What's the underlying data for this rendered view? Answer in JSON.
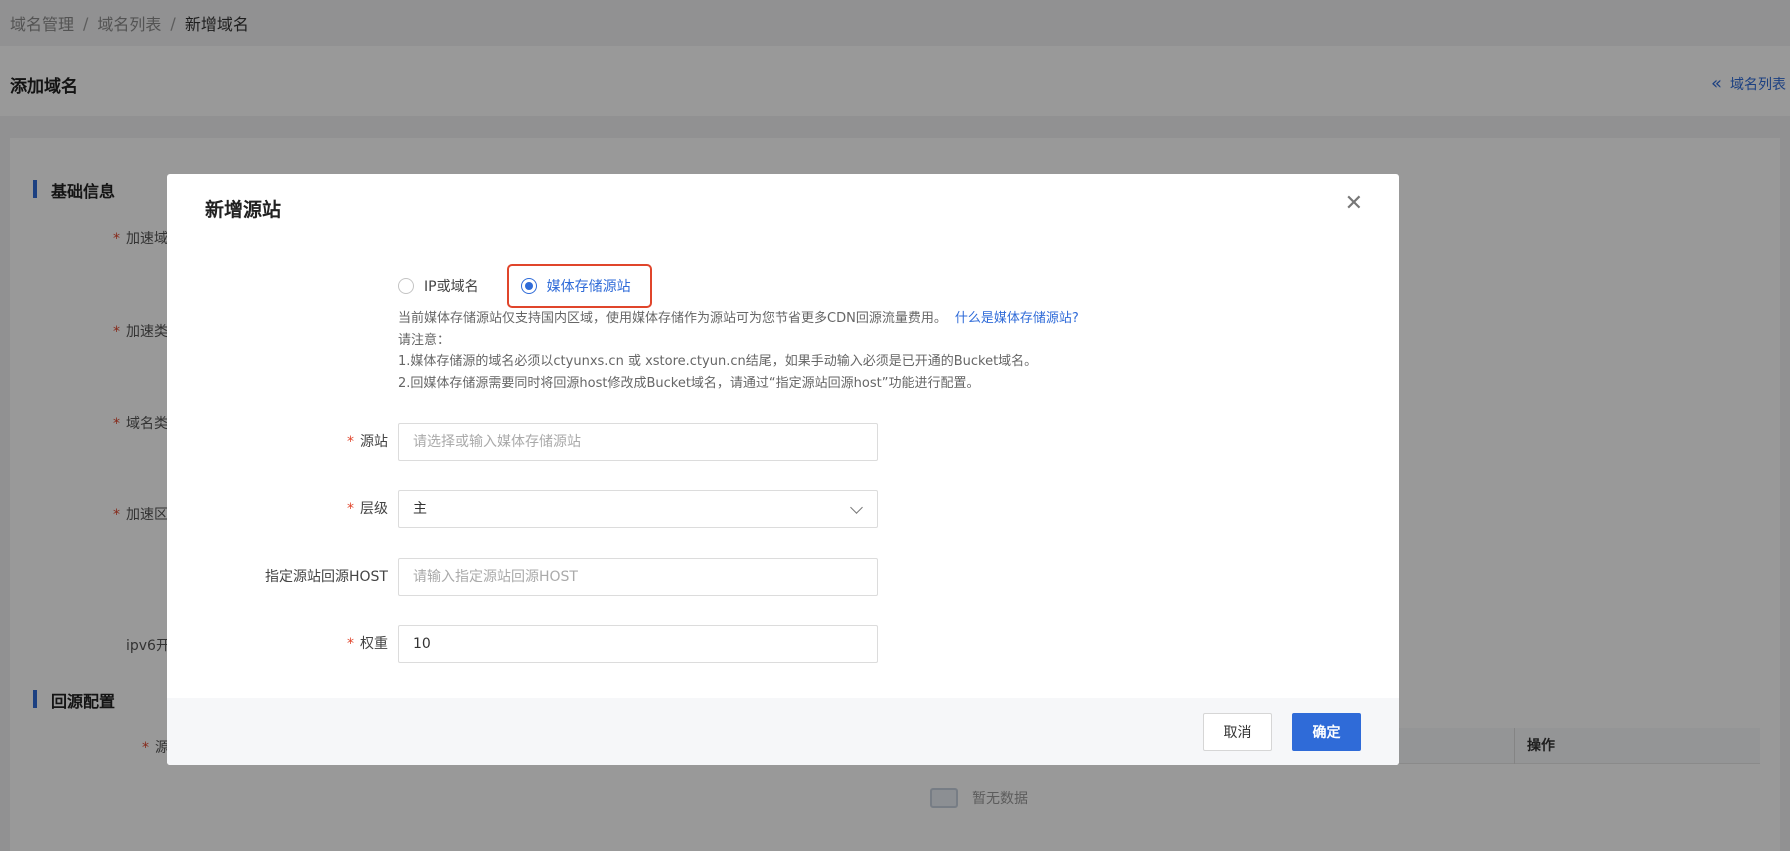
{
  "breadcrumb": {
    "items": [
      "域名管理",
      "域名列表",
      "新增域名"
    ]
  },
  "page": {
    "title": "添加域名",
    "back_link": "域名列表"
  },
  "background_form": {
    "section_basic": "基础信息",
    "fields": [
      "加速域",
      "加速类",
      "域名类",
      "加速区",
      "ipv6开"
    ],
    "section_origin": "回源配置",
    "origin_field": "源",
    "table_ops_header": "操作",
    "empty_text": "暂无数据"
  },
  "modal": {
    "title": "新增源站",
    "origin_type": {
      "options": [
        "IP或域名",
        "媒体存储源站"
      ],
      "selected": "媒体存储源站"
    },
    "notes": {
      "line1": "当前媒体存储源站仅支持国内区域，使用媒体存储作为源站可为您节省更多CDN回源流量费用。",
      "line1_link": "什么是媒体存储源站?",
      "line2": "请注意：",
      "line3": "1.媒体存储源的域名必须以ctyunxs.cn 或 xstore.ctyun.cn结尾，如果手动输入必须是已开通的Bucket域名。",
      "line4": "2.回媒体存储源需要同时将回源host修改成Bucket域名，请通过“指定源站回源host”功能进行配置。"
    },
    "fields": {
      "origin": {
        "label": "源站",
        "placeholder": "请选择或输入媒体存储源站",
        "value": ""
      },
      "level": {
        "label": "层级",
        "value": "主"
      },
      "host": {
        "label": "指定源站回源HOST",
        "placeholder": "请输入指定源站回源HOST",
        "value": ""
      },
      "weight": {
        "label": "权重",
        "value": "10"
      }
    },
    "footer": {
      "cancel_label": "取消",
      "confirm_label": "确定"
    }
  },
  "colors": {
    "accent": "#2f6bd8",
    "required": "#e0452b",
    "highlight": "#e0452b"
  }
}
